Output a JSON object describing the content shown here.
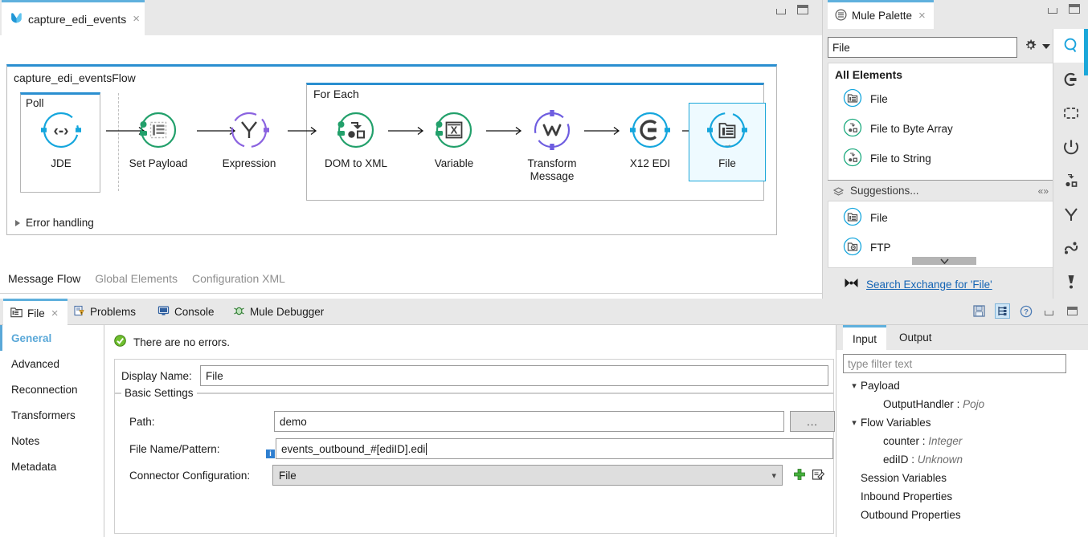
{
  "editor": {
    "tab": {
      "label": "capture_edi_events",
      "icon": "mule-app-icon",
      "close": "×"
    },
    "window_controls": {
      "minimize": "minimize-icon",
      "maximize": "maximize-icon"
    },
    "flow": {
      "title": "capture_edi_eventsFlow",
      "error_handling": "Error handling",
      "poll_label": "Poll",
      "foreach_label": "For Each",
      "nodes": [
        {
          "caption": "JDE",
          "icon": "jde-connector-icon",
          "color": "#15a6dd"
        },
        {
          "caption": "Set Payload",
          "icon": "set-payload-icon",
          "color": "#22a06b"
        },
        {
          "caption": "Expression",
          "icon": "expression-filter-icon",
          "color": "#8b63e0"
        },
        {
          "caption": "DOM to XML",
          "icon": "dom-to-xml-icon",
          "color": "#22a06b"
        },
        {
          "caption": "Variable",
          "icon": "variable-icon",
          "color": "#22a06b"
        },
        {
          "caption": "Transform\nMessage",
          "icon": "transform-message-icon",
          "color": "#6e5de0"
        },
        {
          "caption": "X12 EDI",
          "icon": "x12-edi-icon",
          "color": "#15a6dd"
        },
        {
          "caption": "File",
          "icon": "file-connector-icon",
          "color": "#15a6dd"
        }
      ]
    },
    "view_tabs": [
      {
        "label": "Message Flow",
        "selected": true
      },
      {
        "label": "Global Elements",
        "selected": false
      },
      {
        "label": "Configuration XML",
        "selected": false
      }
    ]
  },
  "palette": {
    "tab": {
      "label": "Mule Palette",
      "icon": "palette-icon",
      "close": "×"
    },
    "search_value": "File",
    "gear": "gear-icon",
    "dropdown": "chevron-down-icon",
    "all_elements_header": "All Elements",
    "all_elements": [
      {
        "label": "File",
        "icon": "file-connector-icon"
      },
      {
        "label": "File to Byte Array",
        "icon": "file-to-byte-array-icon"
      },
      {
        "label": "File to String",
        "icon": "file-to-string-icon"
      }
    ],
    "suggestions_header": "Suggestions...",
    "suggestions": [
      {
        "label": "File",
        "icon": "file-connector-icon"
      },
      {
        "label": "FTP",
        "icon": "ftp-connector-icon"
      }
    ],
    "exchange_link": "Search Exchange for 'File'",
    "exchange_icon": "exchange-icon",
    "rail": [
      {
        "icon": "search-icon",
        "active": true
      },
      {
        "icon": "connectors-icon",
        "active": false
      },
      {
        "icon": "scopes-icon",
        "active": false
      },
      {
        "icon": "core-icon",
        "active": false
      },
      {
        "icon": "transformers-icon",
        "active": false
      },
      {
        "icon": "filters-icon",
        "active": false
      },
      {
        "icon": "flow-control-icon",
        "active": false
      },
      {
        "icon": "error-handling-icon",
        "active": false
      }
    ]
  },
  "bottom_tabs": [
    {
      "label": "File",
      "icon": "file-properties-icon",
      "selected": true,
      "close": "×"
    },
    {
      "label": "Problems",
      "icon": "problems-icon",
      "selected": false
    },
    {
      "label": "Console",
      "icon": "console-icon",
      "selected": false
    },
    {
      "label": "Mule Debugger",
      "icon": "mule-debugger-icon",
      "selected": false
    }
  ],
  "bottom_tools": [
    {
      "icon": "save-icon",
      "on": false
    },
    {
      "icon": "tree-view-icon",
      "on": true
    },
    {
      "icon": "help-icon",
      "on": false
    },
    {
      "icon": "minimize-icon",
      "on": false
    },
    {
      "icon": "maximize-icon",
      "on": false
    }
  ],
  "properties": {
    "sidebar": [
      {
        "label": "General",
        "selected": true
      },
      {
        "label": "Advanced",
        "selected": false
      },
      {
        "label": "Reconnection",
        "selected": false
      },
      {
        "label": "Transformers",
        "selected": false
      },
      {
        "label": "Notes",
        "selected": false
      },
      {
        "label": "Metadata",
        "selected": false
      }
    ],
    "status": {
      "text": "There are no errors.",
      "icon": "success-check-icon"
    },
    "display_name_label": "Display Name:",
    "display_name_value": "File",
    "basic_settings_legend": "Basic Settings",
    "path_label": "Path:",
    "path_value": "demo",
    "browse_button": "...",
    "file_pattern_label": "File Name/Pattern:",
    "file_pattern_value": "events_outbound_#[ediID].edi",
    "file_pattern_info": "i",
    "connector_config_label": "Connector Configuration:",
    "connector_config_value": "File",
    "add_config_icon": "plus-icon",
    "edit_config_icon": "edit-icon"
  },
  "metadata": {
    "tabs": [
      {
        "label": "Input",
        "selected": true
      },
      {
        "label": "Output",
        "selected": false
      }
    ],
    "filter_placeholder": "type filter text",
    "tree": [
      {
        "label": "Payload",
        "type": "",
        "indent": 0,
        "twisty": "expanded"
      },
      {
        "label": "OutputHandler",
        "type": "Pojo",
        "indent": 1,
        "twisty": "none"
      },
      {
        "label": "Flow Variables",
        "type": "",
        "indent": 0,
        "twisty": "expanded"
      },
      {
        "label": "counter",
        "type": "Integer",
        "indent": 1,
        "twisty": "none"
      },
      {
        "label": "ediID",
        "type": "Unknown",
        "indent": 1,
        "twisty": "none"
      },
      {
        "label": "Session Variables",
        "type": "",
        "indent": 0,
        "twisty": "none"
      },
      {
        "label": "Inbound Properties",
        "type": "",
        "indent": 0,
        "twisty": "none"
      },
      {
        "label": "Outbound Properties",
        "type": "",
        "indent": 0,
        "twisty": "none"
      }
    ]
  },
  "colors": {
    "accent_blue": "#1ba7d9",
    "tab_active_blue": "#5fb0dd",
    "green": "#22a06b",
    "purple": "#6e5de0",
    "link": "#1464b4",
    "panel_bg": "#e8e8e8"
  }
}
